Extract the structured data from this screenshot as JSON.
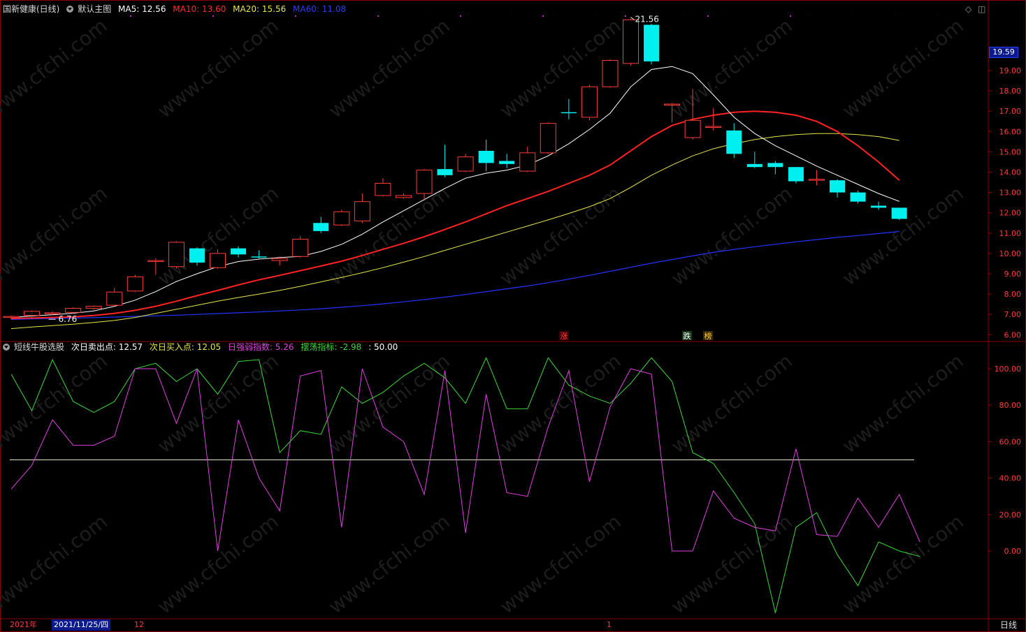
{
  "header": {
    "stock_name": "国新健康(日线)",
    "template": "默认主图",
    "ma5_label": "MA5: 12.56",
    "ma10_label": "MA10: 13.60",
    "ma20_label": "MA20: 15.56",
    "ma60_label": "MA60: 11.08"
  },
  "colors": {
    "up": "#ff3b3b",
    "down": "#00f0f0",
    "ma5": "#ffffff",
    "ma10": "#ff2222",
    "ma20": "#e6e64a",
    "ma60": "#2232ff",
    "grid": "#8b0000",
    "rsi": "#e040e0",
    "swing": "#3ad83a"
  },
  "indicator_header": {
    "name": "短线牛股选股",
    "sell_label": "次日卖出点: 12.57",
    "buy_label": "次日买入点: 12.05",
    "strength_label": "日强弱指数: 5.26",
    "swing_label": "摆荡指标: -2.98",
    "ref_label": ": 50.00"
  },
  "current_price_tag": "19.59",
  "price_axis_ticks": [
    "19.00",
    "18.00",
    "17.00",
    "16.00",
    "15.00",
    "14.00",
    "13.00",
    "12.00",
    "11.00",
    "10.00",
    "9.00",
    "8.00",
    "7.00",
    "6.00"
  ],
  "indicator_axis_ticks": [
    "100.00",
    "80.00",
    "60.00",
    "40.00",
    "20.00",
    "0.00"
  ],
  "annotations": {
    "high": "21.56",
    "low": "6.76",
    "zhang": "涨",
    "die": "跌",
    "bang": "榜"
  },
  "timeline": {
    "year": "2021年",
    "cursor_date": "2021/11/25/四",
    "month_12": "12",
    "month_1": "1",
    "period": "日线"
  },
  "watermark": "www.cfchi.com",
  "chart_data": {
    "type": "candlestick",
    "ylim": [
      6.0,
      20.0
    ],
    "indicator_ylim": [
      -35,
      110
    ],
    "reference_line": 50,
    "candles": [
      {
        "o": 6.85,
        "h": 6.95,
        "l": 6.76,
        "c": 6.9
      },
      {
        "o": 6.95,
        "h": 7.2,
        "l": 6.85,
        "c": 7.15
      },
      {
        "o": 7.05,
        "h": 7.15,
        "l": 6.98,
        "c": 7.08
      },
      {
        "o": 7.1,
        "h": 7.35,
        "l": 7.05,
        "c": 7.3
      },
      {
        "o": 7.3,
        "h": 7.45,
        "l": 7.22,
        "c": 7.4
      },
      {
        "o": 7.45,
        "h": 8.3,
        "l": 7.4,
        "c": 8.1
      },
      {
        "o": 8.15,
        "h": 8.95,
        "l": 8.1,
        "c": 8.85
      },
      {
        "o": 9.65,
        "h": 9.75,
        "l": 8.95,
        "c": 9.65
      },
      {
        "o": 9.35,
        "h": 10.6,
        "l": 9.25,
        "c": 10.55
      },
      {
        "o": 10.25,
        "h": 10.3,
        "l": 9.4,
        "c": 9.55
      },
      {
        "o": 9.3,
        "h": 10.2,
        "l": 9.25,
        "c": 10.0
      },
      {
        "o": 10.25,
        "h": 10.35,
        "l": 9.8,
        "c": 9.95
      },
      {
        "o": 9.85,
        "h": 10.15,
        "l": 9.75,
        "c": 9.8
      },
      {
        "o": 9.65,
        "h": 9.85,
        "l": 9.4,
        "c": 9.75
      },
      {
        "o": 9.85,
        "h": 10.85,
        "l": 9.8,
        "c": 10.7
      },
      {
        "o": 11.5,
        "h": 11.8,
        "l": 11.0,
        "c": 11.1
      },
      {
        "o": 11.4,
        "h": 12.15,
        "l": 11.35,
        "c": 12.05
      },
      {
        "o": 11.6,
        "h": 12.95,
        "l": 11.5,
        "c": 12.55
      },
      {
        "o": 12.85,
        "h": 13.7,
        "l": 12.8,
        "c": 13.45
      },
      {
        "o": 12.75,
        "h": 12.95,
        "l": 12.7,
        "c": 12.85
      },
      {
        "o": 12.95,
        "h": 14.15,
        "l": 12.6,
        "c": 14.1
      },
      {
        "o": 14.15,
        "h": 15.35,
        "l": 13.75,
        "c": 13.85
      },
      {
        "o": 14.05,
        "h": 14.9,
        "l": 14.0,
        "c": 14.75
      },
      {
        "o": 15.05,
        "h": 15.6,
        "l": 14.05,
        "c": 14.45
      },
      {
        "o": 14.55,
        "h": 14.9,
        "l": 14.2,
        "c": 14.4
      },
      {
        "o": 14.05,
        "h": 15.25,
        "l": 14.0,
        "c": 14.95
      },
      {
        "o": 14.95,
        "h": 16.45,
        "l": 14.9,
        "c": 16.4
      },
      {
        "o": 16.95,
        "h": 17.6,
        "l": 16.6,
        "c": 16.9
      },
      {
        "o": 16.7,
        "h": 18.3,
        "l": 16.55,
        "c": 18.2
      },
      {
        "o": 18.2,
        "h": 19.55,
        "l": 18.15,
        "c": 19.5
      },
      {
        "o": 19.35,
        "h": 21.56,
        "l": 19.25,
        "c": 21.5
      },
      {
        "o": 21.25,
        "h": 21.3,
        "l": 19.3,
        "c": 19.45
      },
      {
        "o": 17.35,
        "h": 17.4,
        "l": 16.45,
        "c": 17.35
      },
      {
        "o": 15.7,
        "h": 18.1,
        "l": 15.6,
        "c": 16.55
      },
      {
        "o": 16.25,
        "h": 17.15,
        "l": 16.05,
        "c": 16.25
      },
      {
        "o": 16.05,
        "h": 16.4,
        "l": 14.7,
        "c": 14.9
      },
      {
        "o": 14.4,
        "h": 15.0,
        "l": 14.2,
        "c": 14.25
      },
      {
        "o": 14.45,
        "h": 14.55,
        "l": 13.9,
        "c": 14.25
      },
      {
        "o": 14.25,
        "h": 14.25,
        "l": 13.45,
        "c": 13.55
      },
      {
        "o": 13.65,
        "h": 14.1,
        "l": 13.35,
        "c": 13.65
      },
      {
        "o": 13.6,
        "h": 13.65,
        "l": 12.75,
        "c": 13.0
      },
      {
        "o": 13.0,
        "h": 13.1,
        "l": 12.45,
        "c": 12.55
      },
      {
        "o": 12.35,
        "h": 12.55,
        "l": 12.15,
        "c": 12.25
      },
      {
        "o": 12.25,
        "h": 12.25,
        "l": 11.65,
        "c": 11.7
      }
    ],
    "ma5": [
      6.85,
      6.92,
      6.98,
      7.06,
      7.17,
      7.4,
      7.7,
      8.12,
      8.62,
      9.0,
      9.35,
      9.6,
      9.72,
      9.8,
      9.85,
      10.1,
      10.45,
      10.95,
      11.55,
      12.1,
      12.65,
      13.2,
      13.7,
      13.95,
      14.1,
      14.35,
      14.8,
      15.4,
      16.1,
      16.9,
      18.2,
      19.05,
      19.2,
      18.85,
      17.8,
      16.7,
      15.9,
      15.3,
      14.8,
      14.3,
      13.85,
      13.4,
      12.95,
      12.56
    ],
    "ma10": [
      6.8,
      6.82,
      6.85,
      6.88,
      6.95,
      7.05,
      7.2,
      7.4,
      7.65,
      7.92,
      8.18,
      8.45,
      8.7,
      8.92,
      9.15,
      9.38,
      9.62,
      9.9,
      10.2,
      10.5,
      10.82,
      11.18,
      11.55,
      11.95,
      12.35,
      12.7,
      13.05,
      13.45,
      13.85,
      14.35,
      15.05,
      15.75,
      16.3,
      16.6,
      16.8,
      16.95,
      17.0,
      16.95,
      16.8,
      16.5,
      16.0,
      15.3,
      14.5,
      13.6
    ],
    "ma20": [
      6.3,
      6.38,
      6.45,
      6.52,
      6.6,
      6.7,
      6.85,
      7.05,
      7.25,
      7.45,
      7.65,
      7.83,
      8.0,
      8.18,
      8.38,
      8.6,
      8.82,
      9.05,
      9.3,
      9.57,
      9.85,
      10.15,
      10.45,
      10.75,
      11.05,
      11.35,
      11.65,
      11.97,
      12.3,
      12.7,
      13.25,
      13.85,
      14.35,
      14.8,
      15.15,
      15.4,
      15.6,
      15.75,
      15.85,
      15.9,
      15.9,
      15.85,
      15.75,
      15.56
    ],
    "ma60": [
      6.75,
      6.78,
      6.8,
      6.82,
      6.84,
      6.87,
      6.9,
      6.93,
      6.96,
      7.0,
      7.04,
      7.08,
      7.12,
      7.17,
      7.22,
      7.28,
      7.35,
      7.43,
      7.52,
      7.62,
      7.73,
      7.85,
      7.98,
      8.12,
      8.26,
      8.4,
      8.56,
      8.74,
      8.92,
      9.12,
      9.32,
      9.52,
      9.7,
      9.88,
      10.05,
      10.2,
      10.33,
      10.45,
      10.57,
      10.68,
      10.79,
      10.88,
      10.98,
      11.08
    ],
    "strength_index": [
      34,
      47,
      72,
      58,
      58,
      63,
      100,
      100,
      70,
      100,
      0,
      72,
      40,
      22,
      96,
      99,
      13,
      100,
      68,
      60,
      31,
      99,
      10,
      86,
      32,
      30,
      68,
      99,
      38,
      79,
      100,
      97,
      0,
      0,
      33,
      18,
      13,
      11,
      56,
      9,
      8,
      29,
      13,
      31,
      5
    ],
    "swing_index": [
      97,
      77,
      105,
      82,
      76,
      82,
      100,
      103,
      93,
      100,
      86,
      104,
      105,
      54,
      66,
      64,
      90,
      81,
      87,
      96,
      103,
      95,
      81,
      106,
      78,
      78,
      106,
      91,
      85,
      81,
      92,
      106,
      93,
      54,
      48,
      32,
      15,
      -34,
      13,
      21,
      -2,
      -19,
      5,
      0,
      -3
    ]
  }
}
